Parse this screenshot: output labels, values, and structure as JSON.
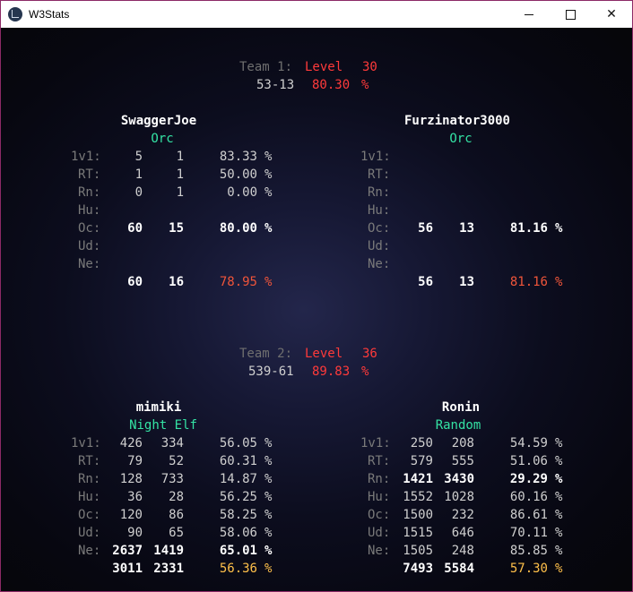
{
  "window": {
    "title": "W3Stats"
  },
  "team1": {
    "label": "Team 1:",
    "level_label": "Level",
    "level": "30",
    "record": "53-13",
    "pct": "80.30",
    "pct_sign": "%",
    "players": [
      {
        "name": "SwaggerJoe",
        "race": "Orc",
        "rows": [
          {
            "label": "1v1:",
            "w": "5",
            "l": "1",
            "pct": "83.33",
            "sign": "%"
          },
          {
            "label": "RT:",
            "w": "1",
            "l": "1",
            "pct": "50.00",
            "sign": "%"
          },
          {
            "label": "Rn:",
            "w": "0",
            "l": "1",
            "pct": "0.00",
            "sign": "%"
          },
          {
            "label": "Hu:",
            "w": "",
            "l": "",
            "pct": "",
            "sign": ""
          },
          {
            "label": "Oc:",
            "w": "60",
            "l": "15",
            "pct": "80.00",
            "sign": "%"
          },
          {
            "label": "Ud:",
            "w": "",
            "l": "",
            "pct": "",
            "sign": ""
          },
          {
            "label": "Ne:",
            "w": "",
            "l": "",
            "pct": "",
            "sign": ""
          }
        ],
        "total": {
          "w": "60",
          "l": "16",
          "pct": "78.95",
          "sign": "%"
        }
      },
      {
        "name": "Furzinator3000",
        "race": "Orc",
        "rows": [
          {
            "label": "1v1:",
            "w": "",
            "l": "",
            "pct": "",
            "sign": ""
          },
          {
            "label": "RT:",
            "w": "",
            "l": "",
            "pct": "",
            "sign": ""
          },
          {
            "label": "Rn:",
            "w": "",
            "l": "",
            "pct": "",
            "sign": ""
          },
          {
            "label": "Hu:",
            "w": "",
            "l": "",
            "pct": "",
            "sign": ""
          },
          {
            "label": "Oc:",
            "w": "56",
            "l": "13",
            "pct": "81.16",
            "sign": "%"
          },
          {
            "label": "Ud:",
            "w": "",
            "l": "",
            "pct": "",
            "sign": ""
          },
          {
            "label": "Ne:",
            "w": "",
            "l": "",
            "pct": "",
            "sign": ""
          }
        ],
        "total": {
          "w": "56",
          "l": "13",
          "pct": "81.16",
          "sign": "%"
        }
      }
    ]
  },
  "team2": {
    "label": "Team 2:",
    "level_label": "Level",
    "level": "36",
    "record": "539-61",
    "pct": "89.83",
    "pct_sign": "%",
    "players": [
      {
        "name": "mimiki",
        "race": "Night Elf",
        "rows": [
          {
            "label": "1v1:",
            "w": "426",
            "l": "334",
            "pct": "56.05",
            "sign": "%"
          },
          {
            "label": "RT:",
            "w": "79",
            "l": "52",
            "pct": "60.31",
            "sign": "%"
          },
          {
            "label": "Rn:",
            "w": "128",
            "l": "733",
            "pct": "14.87",
            "sign": "%"
          },
          {
            "label": "Hu:",
            "w": "36",
            "l": "28",
            "pct": "56.25",
            "sign": "%"
          },
          {
            "label": "Oc:",
            "w": "120",
            "l": "86",
            "pct": "58.25",
            "sign": "%"
          },
          {
            "label": "Ud:",
            "w": "90",
            "l": "65",
            "pct": "58.06",
            "sign": "%"
          },
          {
            "label": "Ne:",
            "w": "2637",
            "l": "1419",
            "pct": "65.01",
            "sign": "%"
          }
        ],
        "total": {
          "w": "3011",
          "l": "2331",
          "pct": "56.36",
          "sign": "%"
        }
      },
      {
        "name": "Ronin",
        "race": "Random",
        "rows": [
          {
            "label": "1v1:",
            "w": "250",
            "l": "208",
            "pct": "54.59",
            "sign": "%"
          },
          {
            "label": "RT:",
            "w": "579",
            "l": "555",
            "pct": "51.06",
            "sign": "%"
          },
          {
            "label": "Rn:",
            "w": "1421",
            "l": "3430",
            "pct": "29.29",
            "sign": "%"
          },
          {
            "label": "Hu:",
            "w": "1552",
            "l": "1028",
            "pct": "60.16",
            "sign": "%"
          },
          {
            "label": "Oc:",
            "w": "1500",
            "l": "232",
            "pct": "86.61",
            "sign": "%"
          },
          {
            "label": "Ud:",
            "w": "1515",
            "l": "646",
            "pct": "70.11",
            "sign": "%"
          },
          {
            "label": "Ne:",
            "w": "1505",
            "l": "248",
            "pct": "85.85",
            "sign": "%"
          }
        ],
        "total": {
          "w": "7493",
          "l": "5584",
          "pct": "57.30",
          "sign": "%"
        }
      }
    ]
  }
}
